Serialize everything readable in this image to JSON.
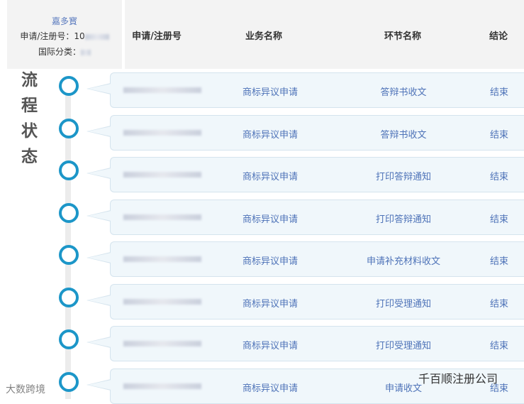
{
  "info": {
    "name": "嘉多寳",
    "reg_label": "申请/注册号：10",
    "class_label": "国际分类："
  },
  "header": {
    "reg_no": "申请/注册号",
    "business": "业务名称",
    "step": "环节名称",
    "conclusion": "结论"
  },
  "side_title": [
    "流",
    "程",
    "状",
    "态"
  ],
  "rows": [
    {
      "business": "商标异议申请",
      "step": "答辩书收文",
      "conclusion": "结束"
    },
    {
      "business": "商标异议申请",
      "step": "答辩书收文",
      "conclusion": "结束"
    },
    {
      "business": "商标异议申请",
      "step": "打印答辩通知",
      "conclusion": "结束"
    },
    {
      "business": "商标异议申请",
      "step": "打印答辩通知",
      "conclusion": "结束"
    },
    {
      "business": "商标异议申请",
      "step": "申请补充材料收文",
      "conclusion": "结束"
    },
    {
      "business": "商标异议申请",
      "step": "打印受理通知",
      "conclusion": "结束"
    },
    {
      "business": "商标异议申请",
      "step": "打印受理通知",
      "conclusion": "结束"
    },
    {
      "business": "商标异议申请",
      "step": "申请收文",
      "conclusion": "结束"
    }
  ],
  "watermarks": {
    "left": "大数跨境",
    "right": "千百顺注册公司"
  },
  "colors": {
    "accent": "#1c96c8",
    "link": "#4e73b8"
  }
}
